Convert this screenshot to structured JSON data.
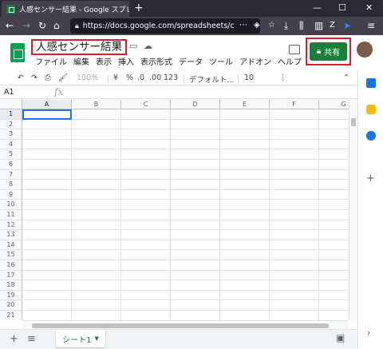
{
  "browser": {
    "tab_title": "人感センサー結果 - Google スプレ",
    "tab_close": "✕",
    "new_tab": "+",
    "window_controls": [
      "—",
      "☐",
      "✕"
    ],
    "url": "https://docs.google.com/spreadsheets/c",
    "nav_icons": [
      "back-icon",
      "forward-icon",
      "reload-icon",
      "home-icon"
    ]
  },
  "app": {
    "doc_title": "人感センサー結果",
    "menus": [
      "ファイル",
      "編集",
      "表示",
      "挿入",
      "表示形式",
      "データ",
      "ツール",
      "アドオン",
      "ヘルプ"
    ],
    "share_label": "共有"
  },
  "toolbar": {
    "zoom": "100%",
    "currency": "¥",
    "percent": "%",
    "dec_decrease": ".0",
    "dec_increase": ".00",
    "more_formats": "123",
    "font": "デフォルト...",
    "font_size": "10",
    "more": "⋮"
  },
  "formula_bar": {
    "cell_ref": "A1",
    "fx": "fx",
    "content": ""
  },
  "grid": {
    "columns": [
      "A",
      "B",
      "C",
      "D",
      "E",
      "F",
      "G"
    ],
    "rows": [
      "1",
      "2",
      "3",
      "4",
      "5",
      "6",
      "7",
      "8",
      "9",
      "10",
      "11",
      "12",
      "13",
      "14",
      "15",
      "16",
      "17",
      "18",
      "19",
      "20",
      "21"
    ],
    "selected_cell": "A1"
  },
  "sheets": {
    "add": "+",
    "list": "≡",
    "active_sheet": "シート1"
  },
  "colors": {
    "accent_green": "#188038",
    "selection_blue": "#1a73e8",
    "highlight_red": "#e21b2c"
  }
}
